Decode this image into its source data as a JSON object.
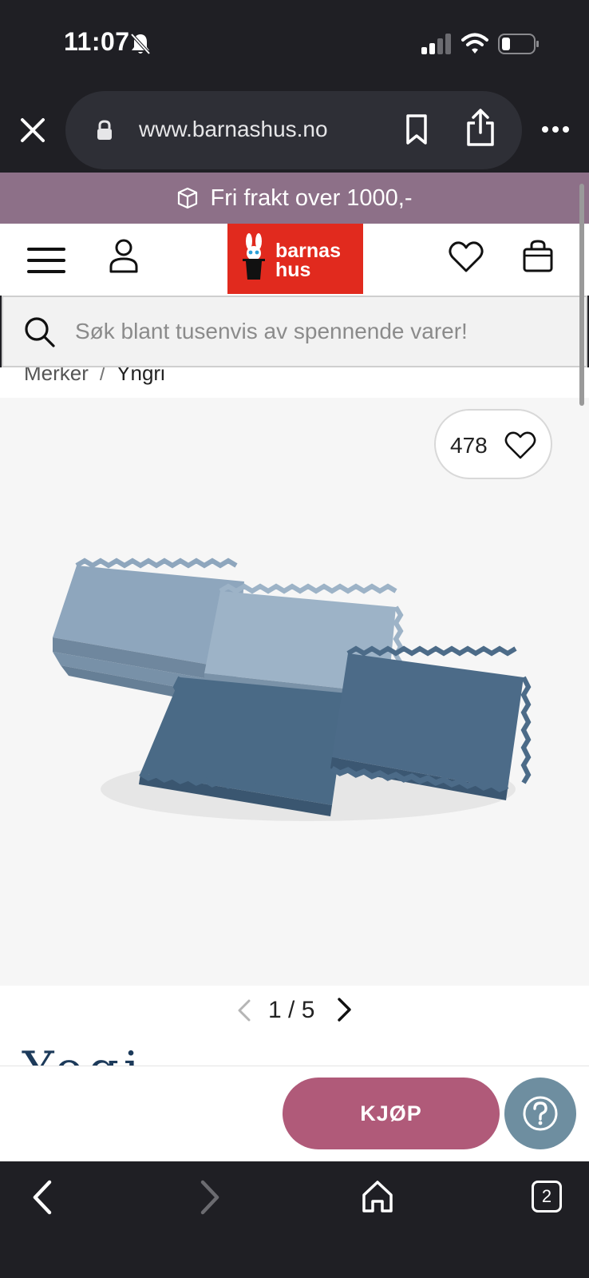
{
  "status_bar": {
    "time": "11:07"
  },
  "browser": {
    "url": "www.barnashus.no",
    "tab_count": "2"
  },
  "promo": {
    "text": "Fri frakt over 1000,-"
  },
  "logo": {
    "line1": "barnas",
    "line2": "hus"
  },
  "search": {
    "placeholder": "Søk blant tusenvis av spennende varer!"
  },
  "breadcrumb": {
    "items": [
      "Merker",
      "Yngri"
    ],
    "separator": "/"
  },
  "product": {
    "like_count": "478",
    "image_icon": "puzzle-foam-mat-image"
  },
  "pager": {
    "text": "1 / 5"
  },
  "brand_peek": {
    "text": "Yogi"
  },
  "actions": {
    "buy_label": "KJØP"
  },
  "colors": {
    "promo_bg": "#8d7088",
    "logo_red": "#e12a1e",
    "buy_button": "#b05a79",
    "help_button": "#6e8ea0",
    "chrome": "#1f1f24"
  }
}
